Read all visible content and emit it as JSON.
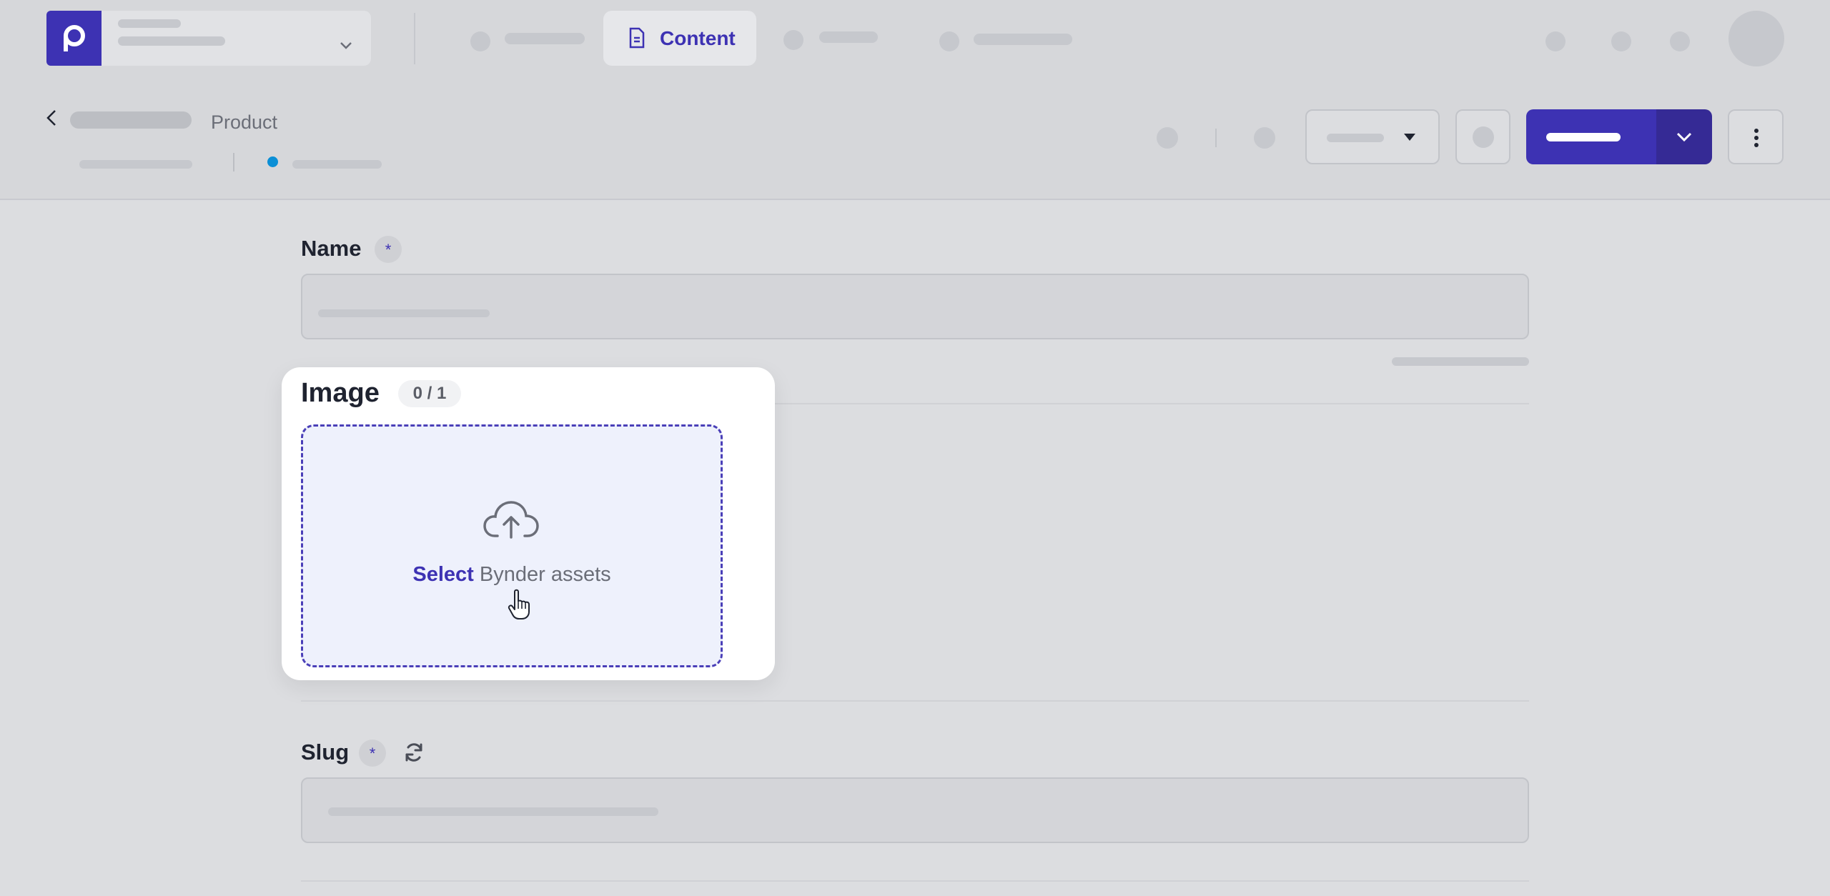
{
  "nav": {
    "active_tab": "Content"
  },
  "header": {
    "entry_type": "Product"
  },
  "fields": {
    "name": {
      "label": "Name",
      "required_mark": "*"
    },
    "image": {
      "label": "Image",
      "count": "0 / 1",
      "select_label": "Select",
      "assets_label": "Bynder assets"
    },
    "slug": {
      "label": "Slug",
      "required_mark": "*"
    }
  },
  "colors": {
    "accent": "#3d32b3",
    "dropzone_bg": "#eef1fc",
    "status_dot": "#0b8fd6"
  },
  "icons": {
    "logo": "p-logo-icon",
    "space_chevron": "chevron-down-icon",
    "tab_content": "document-icon",
    "back": "chevron-left-icon",
    "publish_caret": "chevron-down-icon",
    "more": "more-vertical-icon",
    "upload": "cloud-upload-icon",
    "regenerate": "refresh-icon"
  }
}
